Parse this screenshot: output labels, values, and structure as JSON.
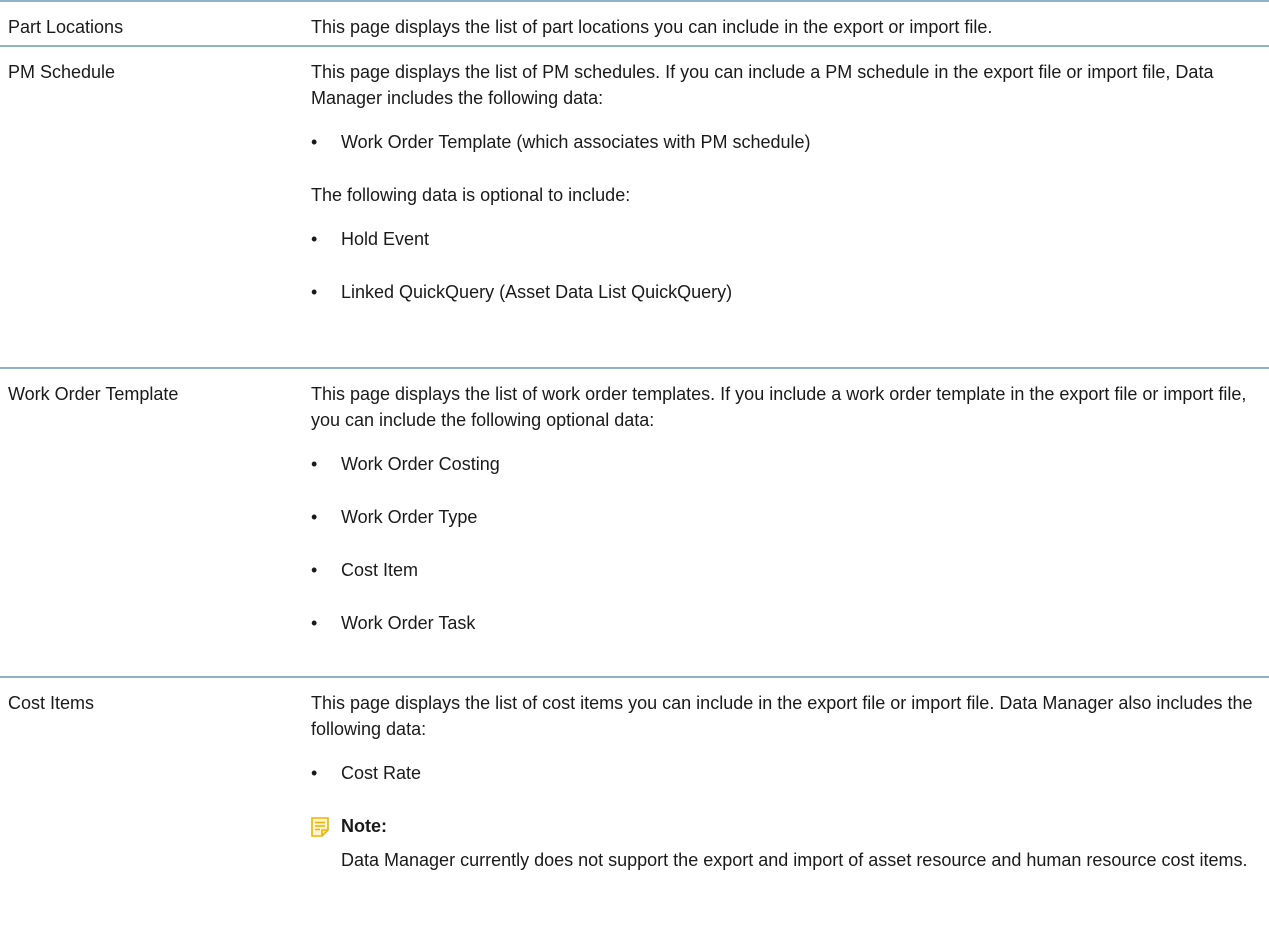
{
  "rows": [
    {
      "label": "Part Locations",
      "text": "This page displays the list of part locations you can include in the export or import file."
    },
    {
      "label": "PM Schedule",
      "intro": "This page displays the list of PM schedules. If you can include a PM schedule in the export file or import file, Data Manager includes the following data:",
      "items1": [
        "Work Order Template (which associates with PM schedule)"
      ],
      "optional_intro": "The following data is optional to include:",
      "items2": [
        "Hold Event",
        "Linked QuickQuery (Asset Data List QuickQuery)"
      ]
    },
    {
      "label": "Work Order Template",
      "intro": "This page displays the list of work order templates. If you include a work order template in the export file or import file, you can include the following optional data:",
      "items": [
        "Work Order Costing",
        "Work Order Type",
        "Cost Item",
        "Work Order Task"
      ]
    },
    {
      "label": "Cost Items",
      "intro": "This page displays the list of cost items you can include in the export file or import file. Data Manager also includes the following data:",
      "items": [
        "Cost Rate"
      ],
      "note_title": "Note:",
      "note_text": "Data Manager currently does not support the export and import of asset resource and human resource cost items."
    }
  ],
  "bullet_glyph": "•",
  "colors": {
    "rule": "#8fb2c9",
    "note_icon": "#f2b300"
  }
}
